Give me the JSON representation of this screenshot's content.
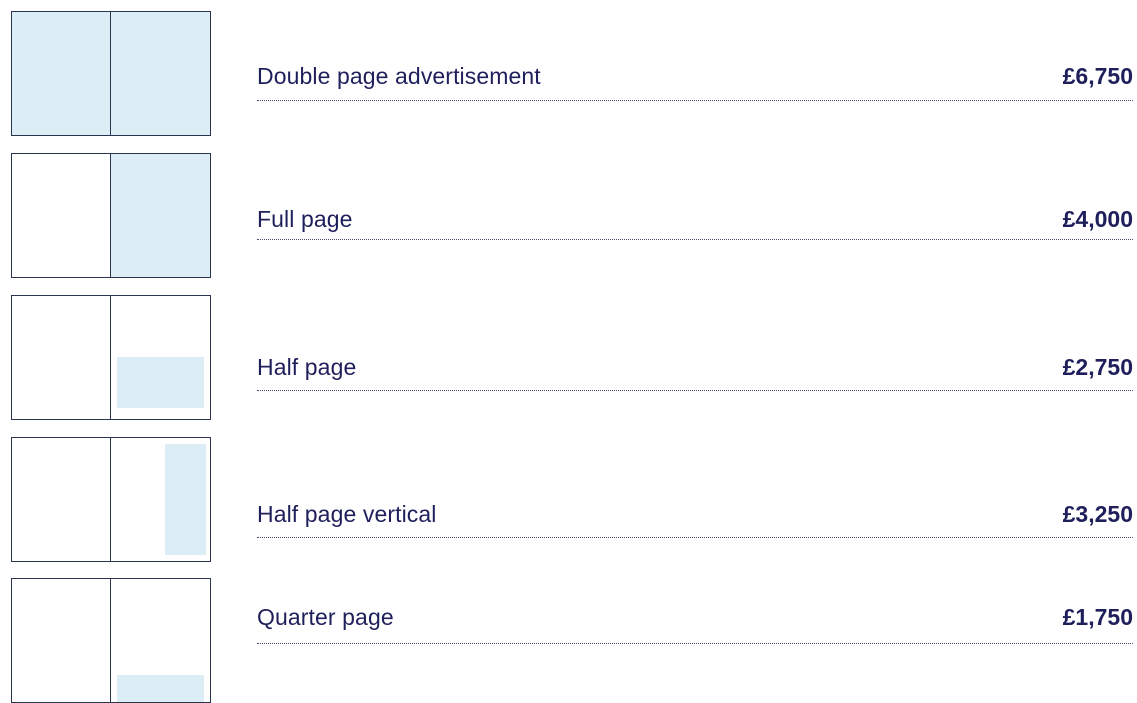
{
  "accent_color": "#1f1f5c",
  "fill_color": "#dcedf5",
  "rates": [
    {
      "label": "Double page advertisement",
      "price": "£6,750",
      "icon": "double-page-spread-icon"
    },
    {
      "label": "Full page",
      "price": "£4,000",
      "icon": "full-page-spread-icon"
    },
    {
      "label": "Half page",
      "price": "£2,750",
      "icon": "half-page-spread-icon"
    },
    {
      "label": "Half page vertical",
      "price": "£3,250",
      "icon": "half-page-vertical-spread-icon"
    },
    {
      "label": "Quarter page",
      "price": "£1,750",
      "icon": "quarter-page-spread-icon"
    }
  ]
}
